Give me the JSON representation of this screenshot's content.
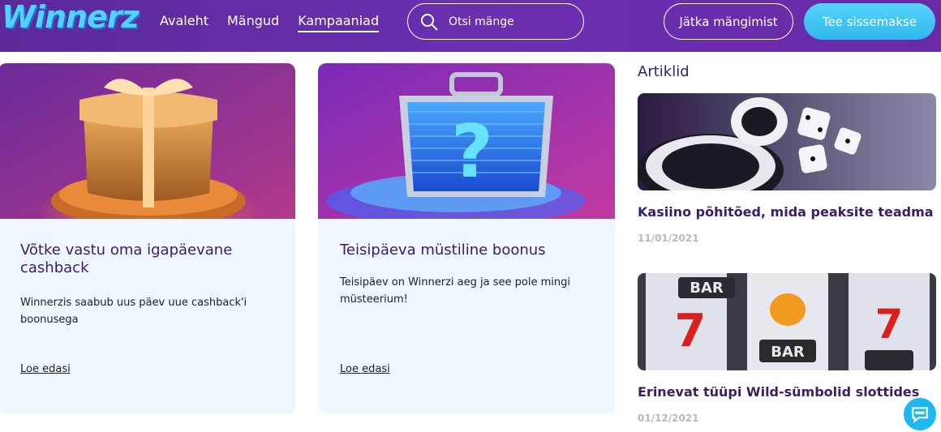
{
  "header": {
    "logo": "Winnerz",
    "nav": [
      "Avaleht",
      "Mängud",
      "Kampaaniad"
    ],
    "active_nav": "Kampaaniad",
    "search_placeholder": "Otsi mänge",
    "continue_label": "Jätka mängimist",
    "deposit_label": "Tee sissemakse"
  },
  "promos": [
    {
      "title": "Võtke vastu oma igapäevane cashback",
      "description": "Winnerzis saabub uus päev uue cashback'i boonusega",
      "link": "Loe edasi",
      "image_icon": "gift-box"
    },
    {
      "title": "Teisipäeva müstiline boonus",
      "description": "Teisipäev on Winnerzi aeg ja see pole mingi müsteerium!",
      "link": "Loe edasi",
      "image_icon": "mystery-briefcase"
    }
  ],
  "articles": {
    "heading": "Artiklid",
    "items": [
      {
        "title": "Kasiino põhitõed, mida peaksite teadma",
        "date": "11/01/2021",
        "image_icon": "chips-and-dice"
      },
      {
        "title": "Erinevat tüüpi Wild-sümbolid slottides",
        "date": "01/12/2021",
        "image_icon": "slot-reels"
      }
    ]
  },
  "slot_symbols": [
    "BAR",
    "7",
    "BAR"
  ],
  "colors": {
    "header_purple": "#6b2fb0",
    "accent_cyan": "#2fb8ee",
    "title_purple": "#3b1d66",
    "card_bg": "#eef6fe"
  }
}
